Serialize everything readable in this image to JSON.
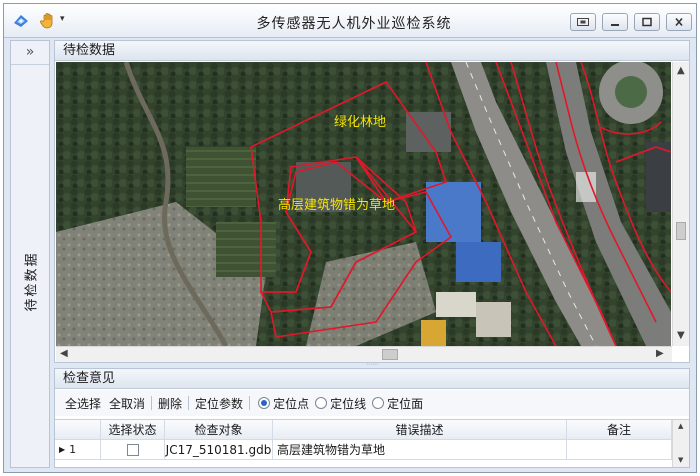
{
  "window": {
    "title": "多传感器无人机外业巡检系统",
    "quick_access_dropdown": "▾"
  },
  "sidebar": {
    "collapse_glyph": "»",
    "label": "待检数据"
  },
  "top_panel": {
    "header": "待检数据",
    "map_labels": {
      "region_1": "绿化林地",
      "region_2": "高层建筑物错为草地"
    },
    "boundary_color": "#e0182a",
    "label_color": "#f6e600"
  },
  "bottom_panel": {
    "header": "检查意见",
    "toolbar": {
      "select_all": "全选择",
      "deselect_all": "全取消",
      "delete": "删除",
      "locate_params": "定位参数",
      "radio_point": "定位点",
      "radio_line": "定位线",
      "radio_area": "定位面",
      "selected_radio": "radio_point"
    },
    "table": {
      "columns": [
        "选择状态",
        "检查对象",
        "错误描述",
        "备注"
      ],
      "rows": [
        {
          "index": "1",
          "checked": false,
          "object": "JC17_510181.gdb",
          "description": "高层建筑物错为草地",
          "remark": ""
        }
      ]
    }
  },
  "icons": {
    "app": "app-logo-icon",
    "hand": "hand-pan-icon",
    "restore": "restore-window-icon",
    "minimize": "minimize-icon",
    "maximize": "maximize-icon",
    "close": "close-icon"
  }
}
